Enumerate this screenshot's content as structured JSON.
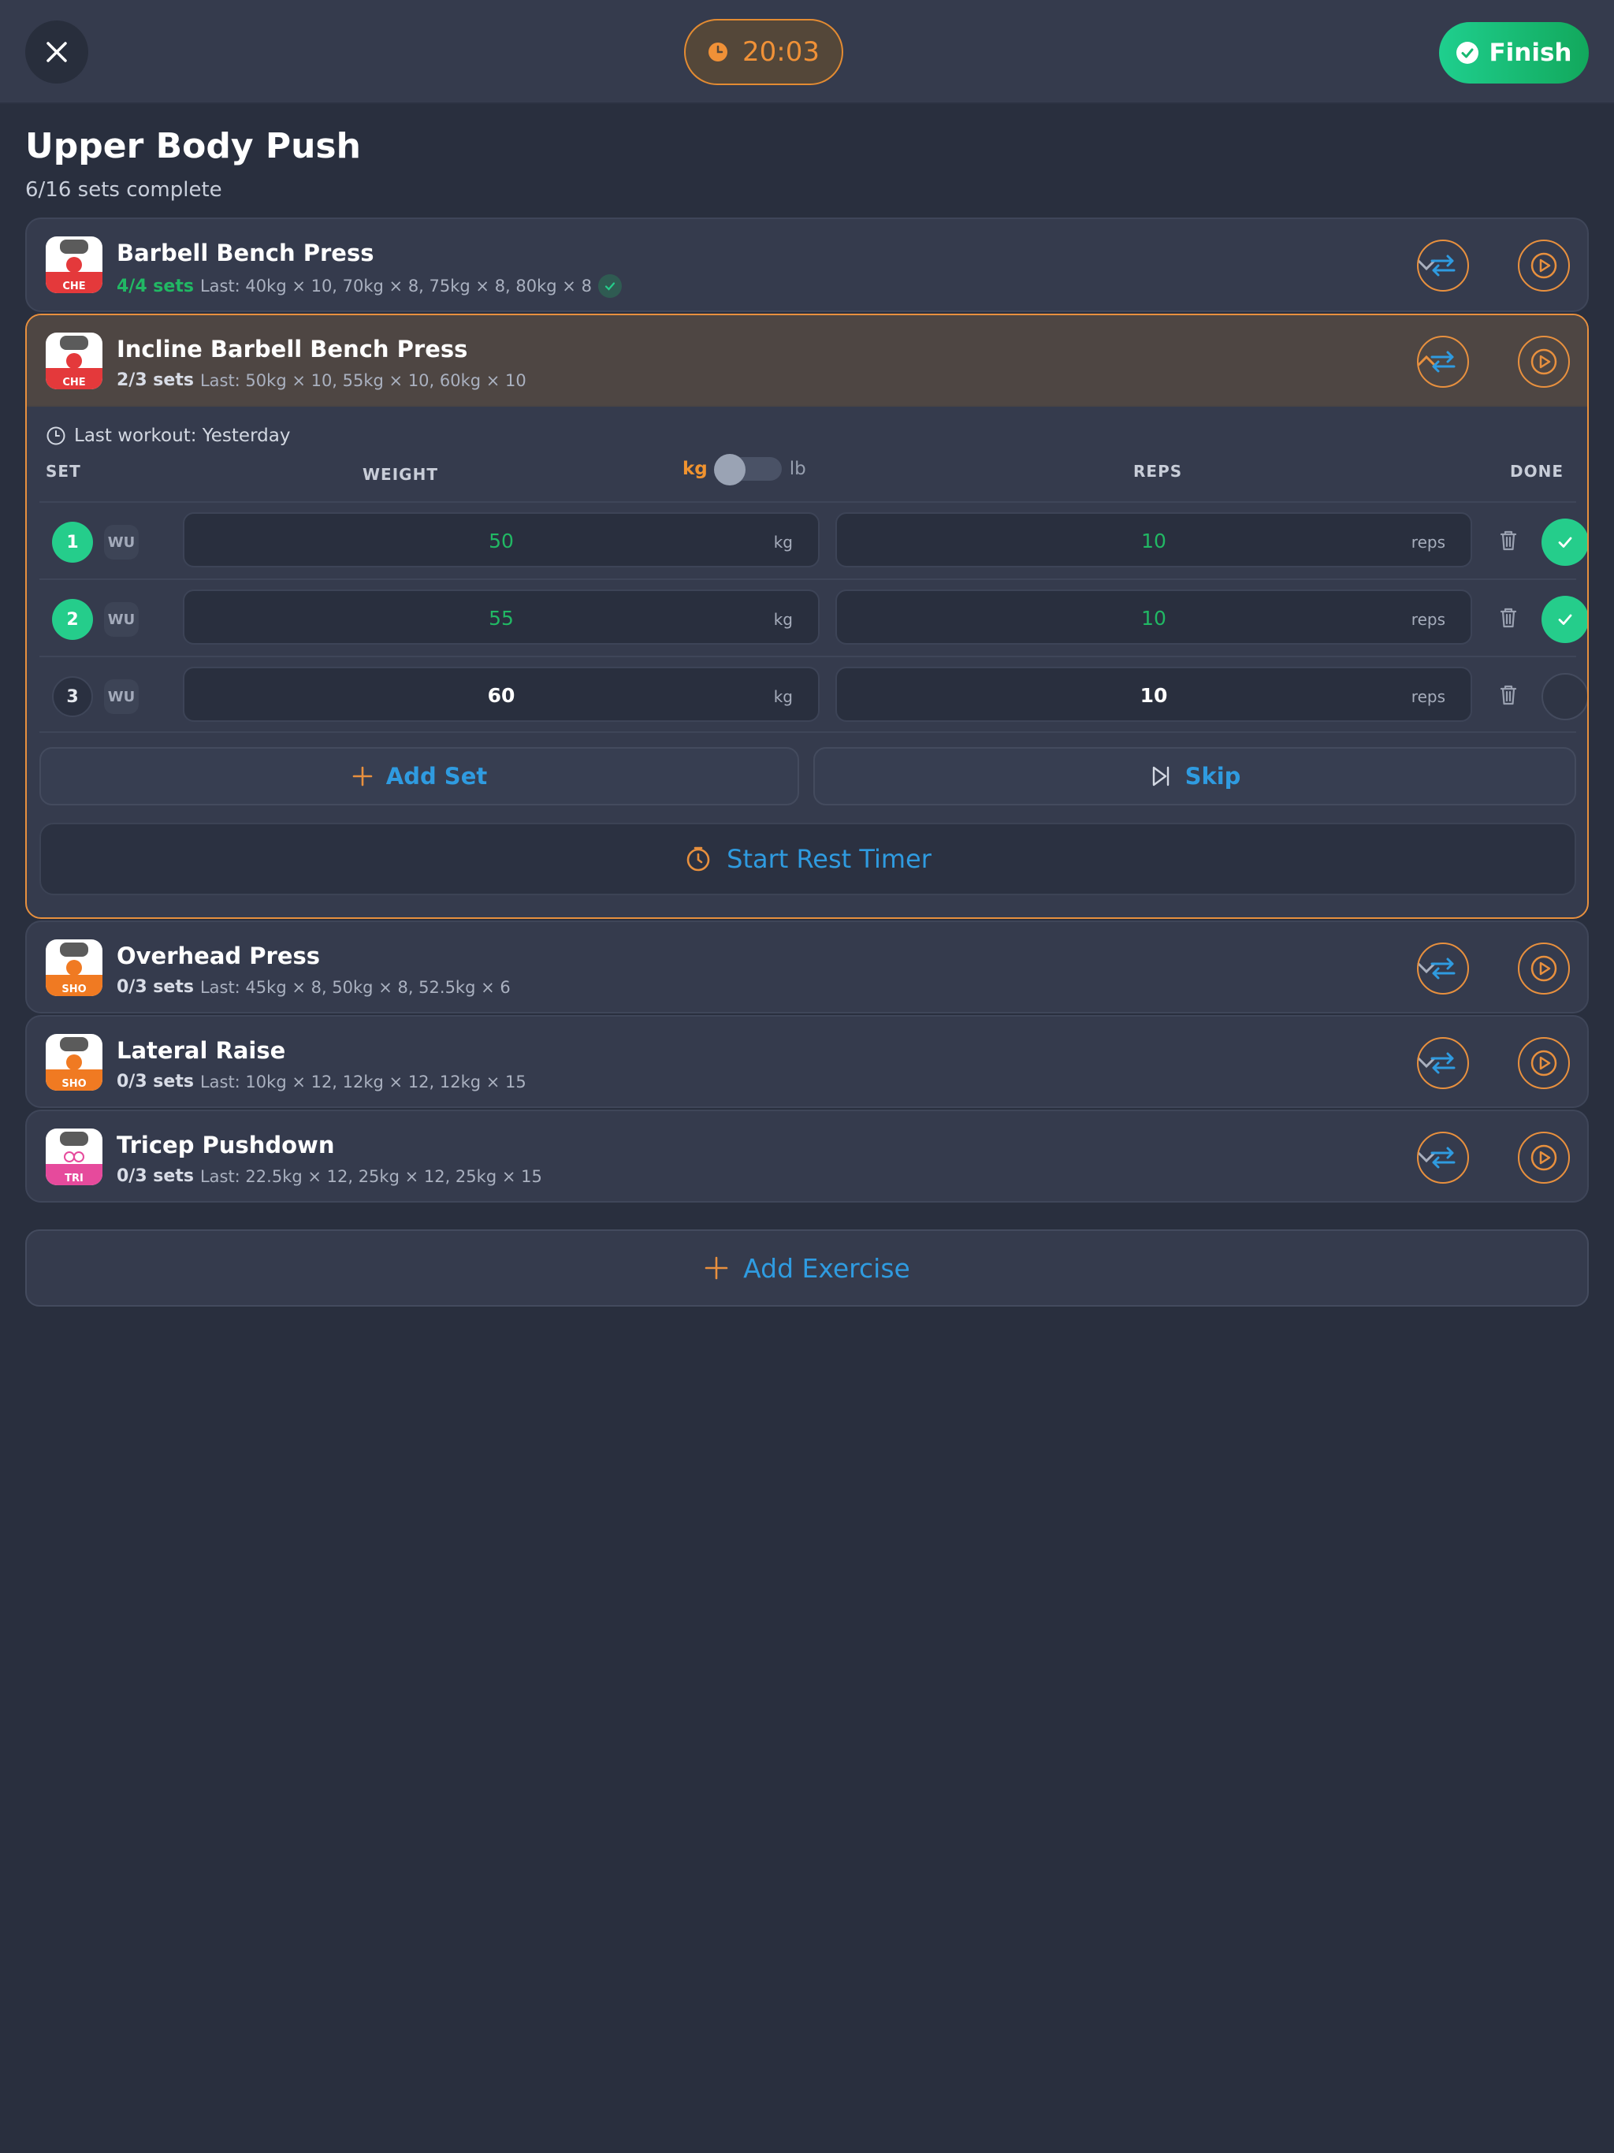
{
  "header": {
    "timer": "20:03",
    "finish_label": "Finish"
  },
  "workout": {
    "title": "Upper Body Push",
    "progress": "6/16 sets complete"
  },
  "exercises": [
    {
      "name": "Barbell Bench Press",
      "sets": "4/4 sets",
      "last": "Last: 40kg × 10, 70kg × 8, 75kg × 8, 80kg × 8",
      "badge": "CHE",
      "badge_color": "#e4393b"
    },
    {
      "name": "Incline Barbell Bench Press",
      "sets": "2/3 sets",
      "last": "Last: 50kg × 10, 55kg × 10, 60kg × 10",
      "badge": "CHE",
      "badge_color": "#e4393b"
    },
    {
      "name": "Overhead Press",
      "sets": "0/3 sets",
      "last": "Last: 45kg × 8, 50kg × 8, 52.5kg × 6",
      "badge": "SHO",
      "badge_color": "#f07a22"
    },
    {
      "name": "Lateral Raise",
      "sets": "0/3 sets",
      "last": "Last: 10kg × 12, 12kg × 12, 12kg × 15",
      "badge": "SHO",
      "badge_color": "#f07a22"
    },
    {
      "name": "Tricep Pushdown",
      "sets": "0/3 sets",
      "last": "Last: 22.5kg × 12, 25kg × 12, 25kg × 15",
      "badge": "TRI",
      "badge_color": "#e64a9c"
    }
  ],
  "active": {
    "last_workout": "Last workout: Yesterday",
    "columns": {
      "set": "SET",
      "weight": "WEIGHT",
      "reps": "REPS",
      "done": "DONE"
    },
    "unit_kg": "kg",
    "unit_lb": "lb",
    "warmup_label": "WU",
    "weight_unit": "kg",
    "reps_unit": "reps",
    "sets": [
      {
        "num": "1",
        "weight": "50",
        "reps": "10",
        "done": true
      },
      {
        "num": "2",
        "weight": "55",
        "reps": "10",
        "done": true
      },
      {
        "num": "3",
        "weight": "60",
        "reps": "10",
        "done": false
      }
    ],
    "add_set_label": "Add Set",
    "skip_label": "Skip",
    "rest_timer_label": "Start Rest Timer"
  },
  "add_exercise_label": "Add Exercise",
  "colors": {
    "accent_orange": "#e8903e",
    "accent_blue": "#2f9be0",
    "success_green": "#25cd8b"
  },
  "icons": [
    "close-icon",
    "clock-icon",
    "check-circle-icon",
    "chevron-down-icon",
    "chevron-up-icon",
    "swap-icon",
    "play-circle-icon",
    "trash-icon",
    "plus-icon",
    "skip-icon",
    "timer-icon"
  ]
}
